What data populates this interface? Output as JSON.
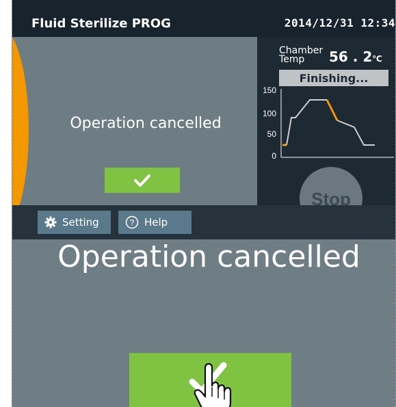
{
  "header": {
    "title": "Fluid Sterilize PROG",
    "datetime": "2014/12/31 12:34"
  },
  "status": {
    "message": "Operation cancelled"
  },
  "panel": {
    "chamber_label_line1": "Chamber",
    "chamber_label_line2": "Temp",
    "temperature": "56 . 2",
    "temperature_unit": "℃",
    "state": "Finishing...",
    "graph": {
      "y_ticks": [
        "150",
        "100",
        "50",
        "0"
      ],
      "completed_color": "#f39800",
      "pending_color": "#cfcfcf"
    }
  },
  "actions": {
    "stop_label": "Stop",
    "setting_label": "Setting",
    "help_label": "Help"
  },
  "zoom": {
    "message": "Operation cancelled"
  },
  "icons": {
    "confirm": "check-icon",
    "setting": "gear-icon",
    "help": "question-circle-icon",
    "pointer": "hand-pointer-icon"
  },
  "colors": {
    "background": "#6e7c84",
    "header": "#17242e",
    "accent": "#f39800",
    "confirm": "#80c241",
    "tool_button": "#5a7a8c"
  }
}
